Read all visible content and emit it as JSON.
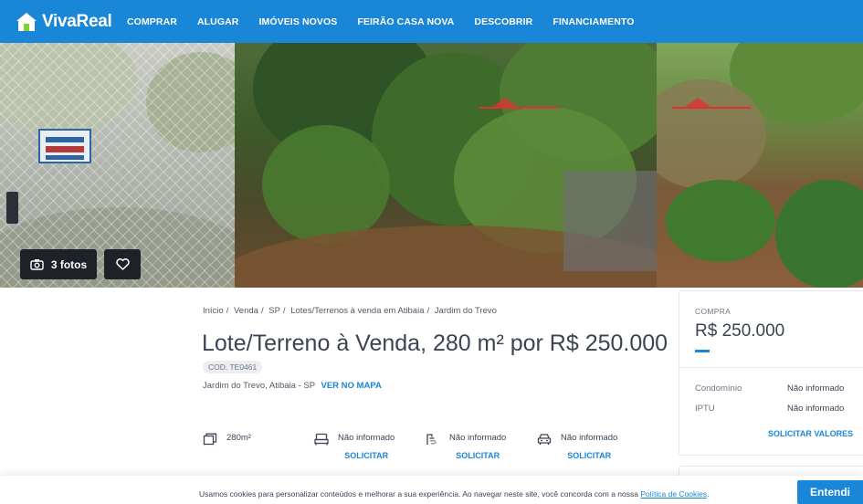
{
  "header": {
    "brand": "VivaReal",
    "nav": [
      "COMPRAR",
      "ALUGAR",
      "IMÓVEIS NOVOS",
      "FEIRÃO CASA NOVA",
      "DESCOBRIR",
      "FINANCIAMENTO"
    ]
  },
  "gallery": {
    "photos_button": "3 fotos",
    "sign_text": "VENDE",
    "watermark": "imoplan"
  },
  "breadcrumb": [
    "Início",
    "Venda",
    "SP",
    "Lotes/Terrenos à venda em Atibaia",
    "Jardim do Trevo"
  ],
  "listing": {
    "title": "Lote/Terreno à Venda, 280 m² por R$ 250.000",
    "code": "COD. TE0461",
    "location": "Jardim do Trevo, Atibaia - SP",
    "map_link": "VER NO MAPA"
  },
  "features": [
    {
      "icon": "area-icon",
      "value": "280m²",
      "action": ""
    },
    {
      "icon": "bed-icon",
      "value": "Não informado",
      "action": "SOLICITAR"
    },
    {
      "icon": "shower-icon",
      "value": "Não informado",
      "action": "SOLICITAR"
    },
    {
      "icon": "car-icon",
      "value": "Não informado",
      "action": "SOLICITAR"
    }
  ],
  "price_card": {
    "label": "COMPRA",
    "price": "R$ 250.000",
    "rows": [
      {
        "key": "Condomínio",
        "value": "Não informado"
      },
      {
        "key": "IPTU",
        "value": "Não informado"
      }
    ],
    "request": "SOLICITAR VALORES"
  },
  "cookie": {
    "text": "Usamos cookies para personalizar conteúdos e melhorar a sua experiência. Ao navegar neste site, você concorda com a nossa",
    "link": "Política de Cookies",
    "button": "Entendi"
  },
  "colors": {
    "primary": "#1a86d8",
    "dark": "#1d2229",
    "text": "#3c4453"
  }
}
